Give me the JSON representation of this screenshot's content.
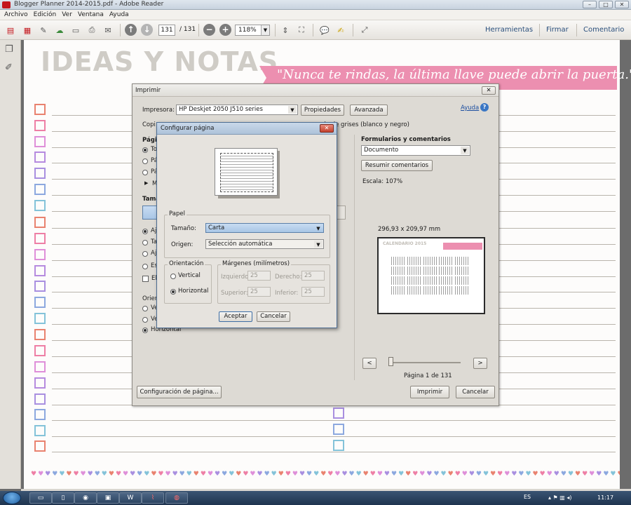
{
  "window": {
    "title": "Blogger Planner 2014-2015.pdf - Adobe Reader",
    "controls": [
      "–",
      "□",
      "✕"
    ]
  },
  "menubar": [
    "Archivo",
    "Edición",
    "Ver",
    "Ventana",
    "Ayuda"
  ],
  "toolbar": {
    "current_page": "131",
    "total_pages": "/ 131",
    "zoom": "118%",
    "right": [
      "Herramientas",
      "Firmar",
      "Comentario"
    ]
  },
  "document": {
    "heading": "IDEAS Y NOTAS",
    "quote": "\"Nunca te rindas, la última llave puede abrir la puerta.\"",
    "checkbox_colors": [
      "#e9826f",
      "#ee7fa5",
      "#df8fd9",
      "#b68bdf",
      "#a98fe0",
      "#8ca8df",
      "#84c3d9",
      "#e9826f",
      "#ee7fa5",
      "#df8fd9",
      "#b68bdf",
      "#a98fe0",
      "#8ca8df",
      "#84c3d9",
      "#e9826f",
      "#ee7fa5",
      "#df8fd9",
      "#b68bdf",
      "#a98fe0",
      "#8ca8df",
      "#84c3d9",
      "#e9826f"
    ],
    "heart_colors": [
      "#ee7fa5",
      "#df8fd9",
      "#a98fe0",
      "#8ca8df",
      "#84c3d9",
      "#e9826f"
    ]
  },
  "print_dialog": {
    "title": "Imprimir",
    "printer_label": "Impresora:",
    "printer_value": "HP Deskjet 2050 J510 series",
    "properties_btn": "Propiedades",
    "advanced_btn": "Avanzada",
    "help_link": "Ayuda",
    "copies_label": "Copi",
    "grayscale_label": "a escala de grises (blanco y negro)",
    "pages_label": "Págin",
    "page_options": [
      "To",
      "Pá",
      "Pá",
      "M"
    ],
    "size_label": "Tama",
    "size_options": [
      "Aj",
      "Ta",
      "Aj",
      "Es",
      "Ele"
    ],
    "orient_label": "Orient",
    "orient_options": [
      "Ve",
      "Ve",
      "Horizontal"
    ],
    "forms_label": "Formularios y comentarios",
    "forms_value": "Documento",
    "summarize_btn": "Resumir comentarios",
    "scale": "Escala: 107%",
    "dims": "296,93 x 209,97 mm",
    "preview_title": "CALENDARIO 2015",
    "page_indicator": "Página 1 de 131",
    "nav_prev": "<",
    "nav_next": ">",
    "page_setup_btn": "Configuración de página...",
    "print_btn": "Imprimir",
    "cancel_btn": "Cancelar",
    "close": "✕"
  },
  "page_setup": {
    "title": "Configurar página",
    "paper_group": "Papel",
    "size_label": "Tamaño:",
    "size_value": "Carta",
    "source_label": "Origen:",
    "source_value": "Selección automática",
    "orientation_group": "Orientación",
    "vertical": "Vertical",
    "horizontal": "Horizontal",
    "margins_group": "Márgenes (milímetros)",
    "left_label": "Izquierdo:",
    "left_value": "25",
    "right_label": "Derecho:",
    "right_value": "25",
    "top_label": "Superior:",
    "top_value": "25",
    "bottom_label": "Inferior:",
    "bottom_value": "25",
    "accept_btn": "Aceptar",
    "cancel_btn": "Cancelar",
    "close": "✕"
  },
  "taskbar": {
    "language": "ES",
    "time": "11:17"
  }
}
